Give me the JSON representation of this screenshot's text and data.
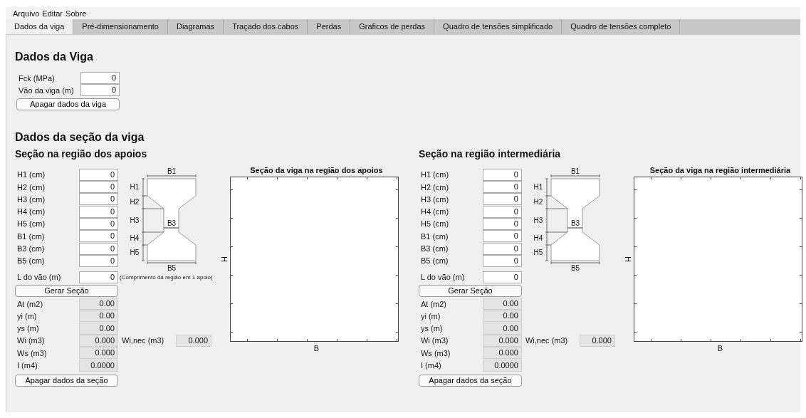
{
  "menu": [
    "Arquivo",
    "Editar",
    "Sobre"
  ],
  "tabs": [
    {
      "label": "Dados da viga",
      "selected": true
    },
    {
      "label": "Pré-dimensionamento",
      "selected": false
    },
    {
      "label": "Diagramas",
      "selected": false
    },
    {
      "label": "Traçado dos cabos",
      "selected": false
    },
    {
      "label": "Perdas",
      "selected": false
    },
    {
      "label": "Graficos de perdas",
      "selected": false
    },
    {
      "label": "Quadro de tensões simplificado",
      "selected": false
    },
    {
      "label": "Quadro de tensões completo",
      "selected": false
    }
  ],
  "beam": {
    "heading": "Dados da Viga",
    "fields": [
      {
        "label": "Fck (MPa)",
        "value": "0"
      },
      {
        "label": "Vão da viga (m)",
        "value": "0"
      }
    ],
    "clear_button": "Apagar dados da viga"
  },
  "section_heading": "Dados da seção da viga",
  "sections": [
    {
      "heading": "Seção na região dos apoios",
      "inputs": [
        {
          "label": "H1 (cm)",
          "value": "0"
        },
        {
          "label": "H2 (cm)",
          "value": "0"
        },
        {
          "label": "H3 (cm)",
          "value": "0"
        },
        {
          "label": "H4 (cm)",
          "value": "0"
        },
        {
          "label": "H5 (cm)",
          "value": "0"
        },
        {
          "label": "B1 (cm)",
          "value": "0"
        },
        {
          "label": "B3 (cm)",
          "value": "0"
        },
        {
          "label": "B5 (cm)",
          "value": "0"
        }
      ],
      "span": {
        "label": "L do vão (m)",
        "value": "0",
        "note": "(Comprimento da região em 1 apoio)"
      },
      "diagram_labels": {
        "b1": "B1",
        "h1": "H1",
        "h2": "H2",
        "h3": "H3",
        "h4": "H4",
        "h5": "H5",
        "b3": "B3",
        "b5": "B5"
      },
      "generate_button": "Gerar Seção",
      "outputs": [
        {
          "label": "At (m2)",
          "value": "0.00"
        },
        {
          "label": "yi (m)",
          "value": "0.00"
        },
        {
          "label": "ys (m)",
          "value": "0.00"
        },
        {
          "label": "Wi (m3)",
          "value": "0.000",
          "extra_label": "Wi,nec (m3)",
          "extra_value": "0.000"
        },
        {
          "label": "Ws (m3)",
          "value": "0.000"
        },
        {
          "label": "I (m4)",
          "value": "0.0000"
        }
      ],
      "clear_button": "Apagar dados da seção",
      "plot": {
        "title": "Seção da viga na região dos apoios",
        "xlabel": "B",
        "ylabel": "H"
      }
    },
    {
      "heading": "Seção na região intermediária",
      "inputs": [
        {
          "label": "H1 (cm)",
          "value": "0"
        },
        {
          "label": "H2 (cm)",
          "value": "0"
        },
        {
          "label": "H3 (cm)",
          "value": "0"
        },
        {
          "label": "H4 (cm)",
          "value": "0"
        },
        {
          "label": "H5 (cm)",
          "value": "0"
        },
        {
          "label": "B1 (cm)",
          "value": "0"
        },
        {
          "label": "B3 (cm)",
          "value": "0"
        },
        {
          "label": "B5 (cm)",
          "value": "0"
        }
      ],
      "span": {
        "label": "L do vão (m)",
        "value": "0"
      },
      "diagram_labels": {
        "b1": "B1",
        "h1": "H1",
        "h2": "H2",
        "h3": "H3",
        "h4": "H4",
        "h5": "H5",
        "b3": "B3",
        "b5": "B5"
      },
      "generate_button": "Gerar Seção",
      "outputs": [
        {
          "label": "At (m2)",
          "value": "0.00"
        },
        {
          "label": "yi (m)",
          "value": "0.00"
        },
        {
          "label": "ys (m)",
          "value": "0.00"
        },
        {
          "label": "Wi (m3)",
          "value": "0.000",
          "extra_label": "Wi,nec (m3)",
          "extra_value": "0.000"
        },
        {
          "label": "Ws (m3)",
          "value": "0.000"
        },
        {
          "label": "I (m4)",
          "value": "0.0000"
        }
      ],
      "clear_button": "Apagar dados da seção",
      "plot": {
        "title": "Seção da viga na região intermediária",
        "xlabel": "B",
        "ylabel": "H"
      }
    }
  ]
}
